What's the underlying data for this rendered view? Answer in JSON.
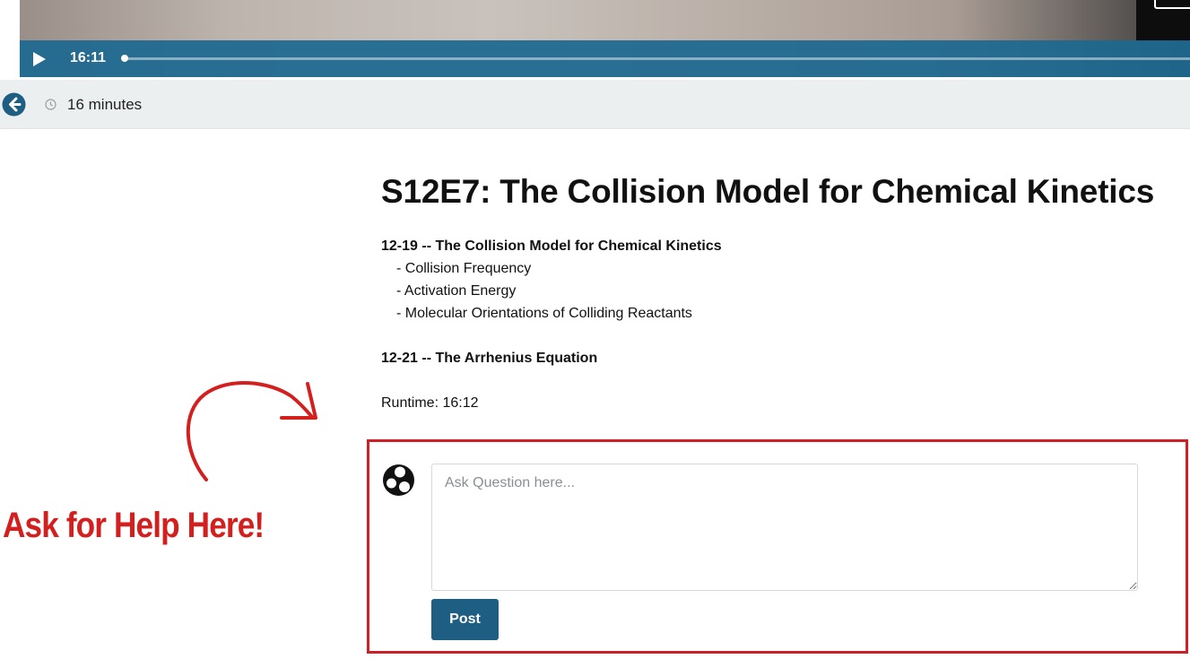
{
  "video": {
    "current_time": "16:11",
    "progress_fraction": 0.0
  },
  "infobar": {
    "duration": "16 minutes"
  },
  "episode": {
    "title": "S12E7: The Collision Model for Chemical Kinetics",
    "sections": [
      {
        "heading": "12-19 -- The Collision Model for Chemical Kinetics",
        "items": [
          "- Collision Frequency",
          "- Activation Energy",
          "- Molecular Orientations of Colliding Reactants"
        ]
      },
      {
        "heading": "12-21 -- The Arrhenius Equation",
        "items": []
      }
    ],
    "runtime": "Runtime: 16:12"
  },
  "annotation": {
    "text": "Ask for Help Here!",
    "color": "#d41f1f"
  },
  "ask": {
    "placeholder": "Ask Question here...",
    "post_label": "Post"
  },
  "colors": {
    "accent": "#1e5e82",
    "controls_bar": "#1d6890",
    "highlight": "#cf2027"
  },
  "icons": [
    "play-icon",
    "back-arrow-icon",
    "clock-icon",
    "avatar-icon"
  ]
}
